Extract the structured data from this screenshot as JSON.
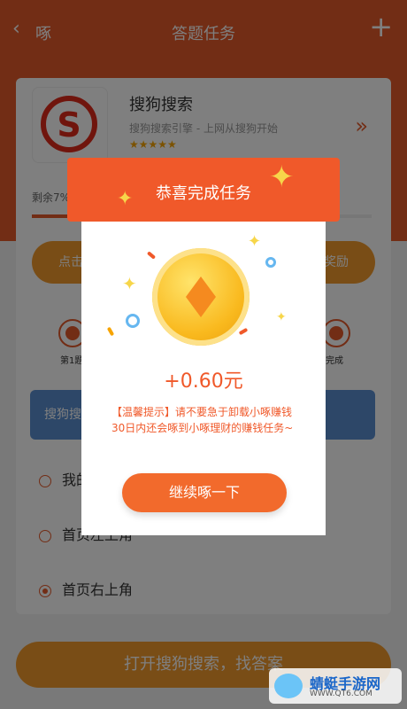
{
  "topbar": {
    "back_label": "啄",
    "title": "答题任务"
  },
  "app": {
    "name": "搜狗搜索",
    "desc": "搜狗搜索引擎 - 上网从搜狗开始",
    "stars": "★★★★★"
  },
  "task": {
    "remaining": "剩余7%",
    "progress_fraction": 0.26
  },
  "actions": {
    "left": "点击",
    "right": "奖励"
  },
  "steps": {
    "first": "第1题",
    "last": "完成"
  },
  "question": {
    "label": "搜狗搜"
  },
  "options": [
    {
      "label": "我的",
      "checked": false
    },
    {
      "label": "首页左上角",
      "checked": false
    },
    {
      "label": "首页右上角",
      "checked": true
    }
  ],
  "bottom_button": "打开搜狗搜索，找答案",
  "modal": {
    "title": "恭喜完成任务",
    "amount": "+0.60元",
    "tips": "【温馨提示】请不要急于卸载小啄赚钱30日内还会啄到小啄理财的赚钱任务~",
    "continue_label": "继续啄一下"
  },
  "watermark": {
    "title": "蜻蜓手游网",
    "url": "WWW.QT6.COM"
  },
  "colors": {
    "brand_orange": "#e55a2b",
    "accent": "#f0592a",
    "question_blue": "#5b8fd1"
  }
}
